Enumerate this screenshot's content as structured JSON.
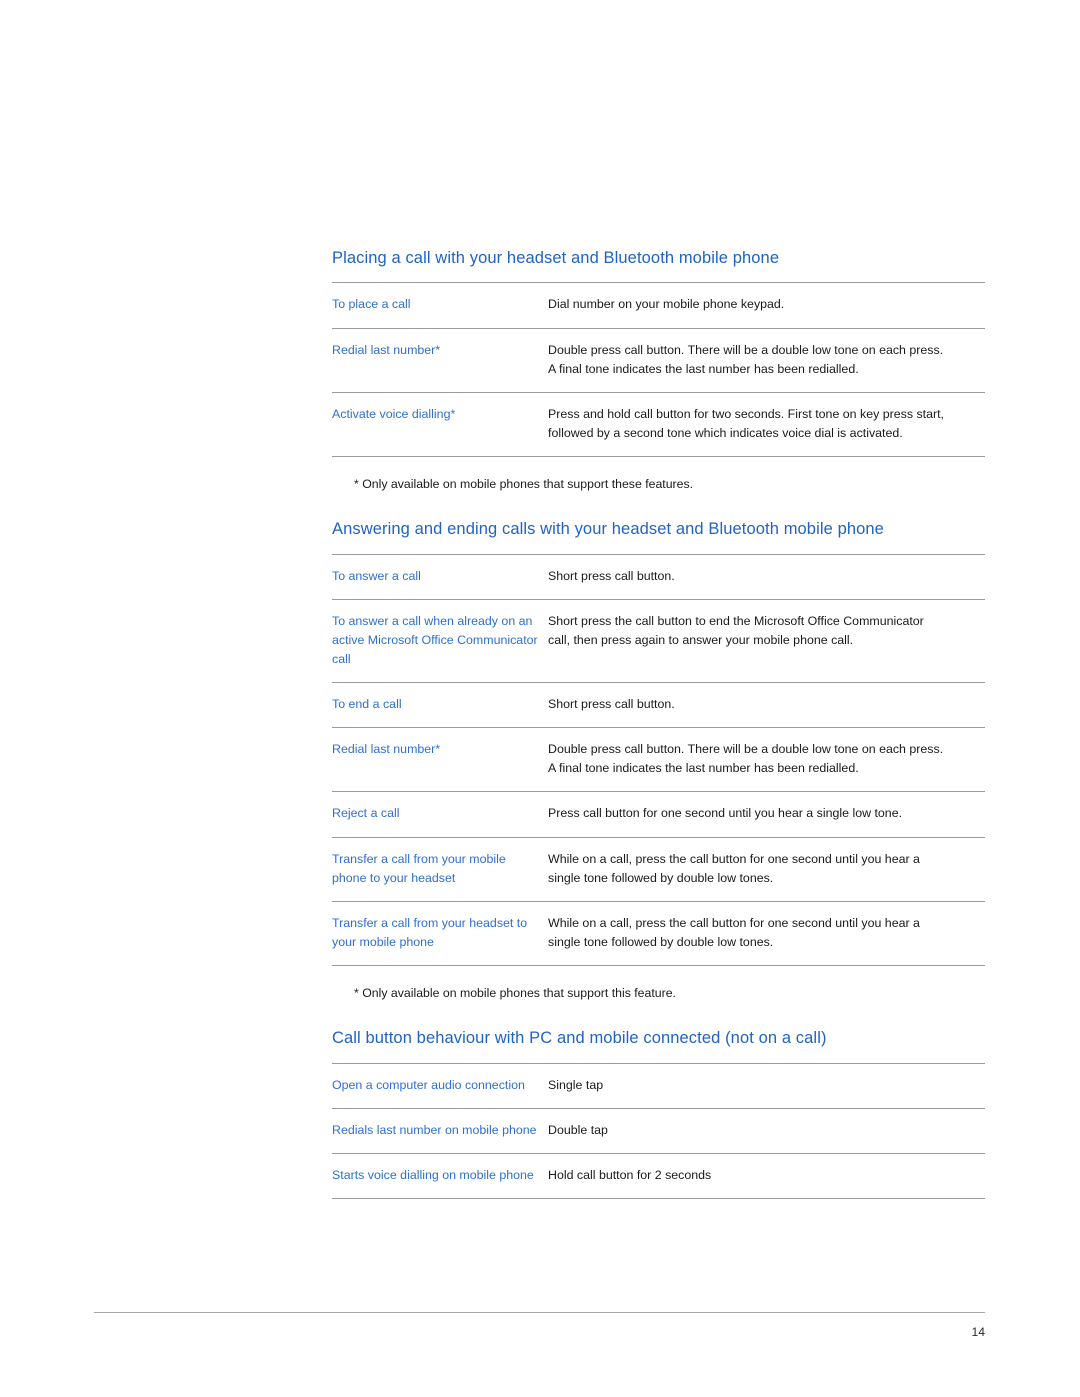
{
  "page": {
    "number": "14",
    "accent_heading_color": "#1f63c4",
    "accent_term_color": "#2f6fd0",
    "rule_color": "#9b9b9b",
    "body_text_color": "#1a1a1a"
  },
  "sections": [
    {
      "heading": "Placing a call with your headset and Bluetooth mobile phone",
      "rows": [
        {
          "term": "To place a call",
          "desc": [
            "Dial number on your mobile phone keypad."
          ]
        },
        {
          "term": "Redial last number*",
          "desc": [
            "Double press call button. There will be a double low tone on each press.",
            "A final tone indicates the last number has been redialled."
          ]
        },
        {
          "term": "Activate voice dialling*",
          "desc": [
            "Press and hold call button for two seconds. First tone on key press start,",
            "followed by a second tone which indicates voice dial is activated."
          ]
        }
      ],
      "footnote": "* Only available on mobile phones that support these features."
    },
    {
      "heading": "Answering and ending calls with your headset and Bluetooth mobile phone",
      "rows": [
        {
          "term": "To answer a call",
          "desc": [
            "Short press call button."
          ]
        },
        {
          "term": "To answer a call when already on an active Microsoft Office Communicator call",
          "desc": [
            "Short press the call button to end the Microsoft Office Communicator",
            "call, then press again to answer your mobile phone call."
          ]
        },
        {
          "term": "To end a call",
          "desc": [
            "Short press call button."
          ]
        },
        {
          "term": "Redial last number*",
          "desc": [
            "Double press call button. There will be a double low tone on each press.",
            "A final tone indicates the last number has been redialled."
          ]
        },
        {
          "term": "Reject a call",
          "desc": [
            "Press call button for one second until you hear a single low tone."
          ]
        },
        {
          "term": "Transfer a call from your mobile phone to your headset",
          "desc": [
            "While on a call, press the call button for one second until you hear a",
            "single tone followed by double low tones."
          ]
        },
        {
          "term": "Transfer a call from your headset to your mobile phone",
          "desc": [
            "While on a call, press the call button for one second until you hear a",
            "single tone followed by double low tones."
          ]
        }
      ],
      "footnote": "* Only available on mobile phones that support this feature."
    },
    {
      "heading": "Call button behaviour with PC and mobile connected (not on a call)",
      "rows": [
        {
          "term": "Open a computer audio connection",
          "desc": [
            "Single tap"
          ]
        },
        {
          "term": "Redials last number on mobile phone",
          "desc": [
            "Double tap"
          ]
        },
        {
          "term": "Starts voice dialling on mobile phone",
          "desc": [
            "Hold call button for 2 seconds"
          ]
        }
      ],
      "footnote": ""
    }
  ]
}
